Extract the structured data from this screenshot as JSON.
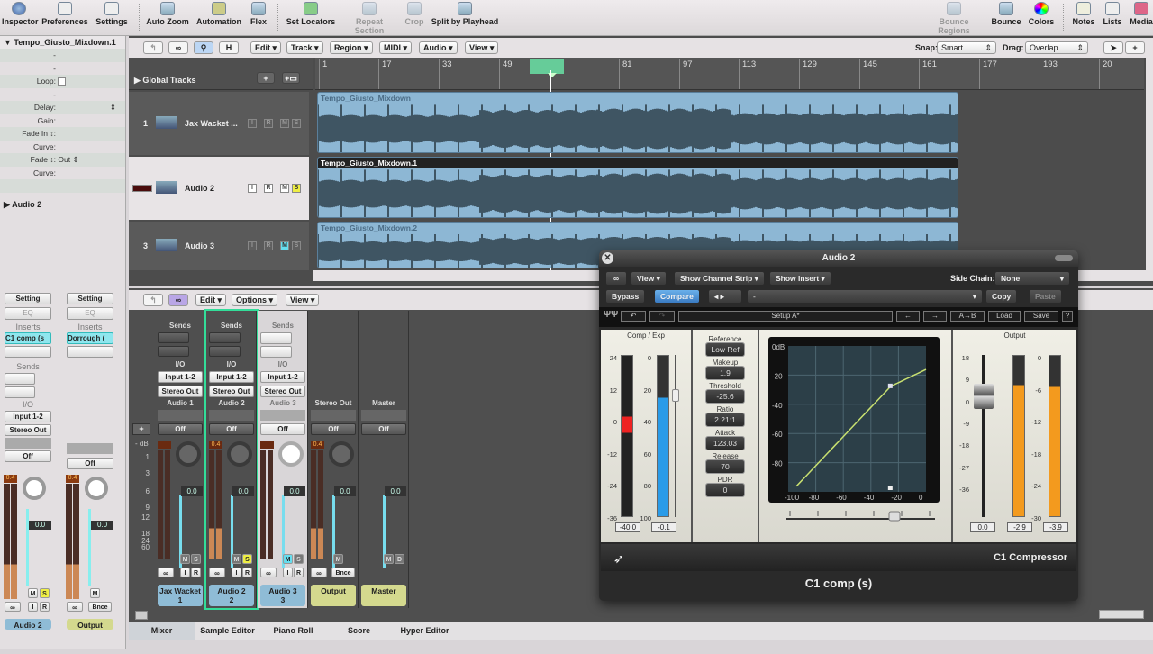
{
  "toolbar": {
    "items": [
      {
        "label": "Inspector",
        "icon": "info-icon"
      },
      {
        "label": "Preferences",
        "icon": "preferences-icon"
      },
      {
        "label": "Settings",
        "icon": "settings-icon"
      },
      {
        "label": "Auto Zoom",
        "icon": "auto-zoom-icon"
      },
      {
        "label": "Automation",
        "icon": "automation-icon"
      },
      {
        "label": "Flex",
        "icon": "flex-icon"
      },
      {
        "label": "Set Locators",
        "icon": "set-locators-icon"
      },
      {
        "label": "Repeat Section",
        "icon": "repeat-section-icon"
      },
      {
        "label": "Crop",
        "icon": "crop-icon"
      },
      {
        "label": "Split by Playhead",
        "icon": "split-icon"
      },
      {
        "label": "Bounce Regions",
        "icon": "bounce-regions-icon"
      },
      {
        "label": "Bounce",
        "icon": "bounce-icon"
      },
      {
        "label": "Colors",
        "icon": "colors-icon"
      },
      {
        "label": "Notes",
        "icon": "notes-icon"
      },
      {
        "label": "Lists",
        "icon": "lists-icon"
      },
      {
        "label": "Media",
        "icon": "media-icon"
      }
    ]
  },
  "inspector": {
    "region_name": "Tempo_Giusto_Mixdown.1",
    "dash": "-",
    "loop_label": "Loop:",
    "delay_label": "Delay:",
    "gain_label": "Gain:",
    "fade_in_label": "Fade In ↕:",
    "curve_label": "Curve:",
    "fade_label": "Fade ↕:",
    "fade_value": "Out",
    "track_section": "Audio 2",
    "strips": [
      {
        "setting": "Setting",
        "eq": "EQ",
        "inserts_label": "Inserts",
        "insert": "C1 comp (s",
        "sends_label": "Sends",
        "io_label": "I/O",
        "input": "Input 1-2",
        "output": "Stereo Out",
        "automation": "Off",
        "peak": "0.4",
        "volume": "0.0",
        "m": "M",
        "s": "S",
        "i": "I",
        "r": "R",
        "name": "Audio 2",
        "color": "#8fbcd6"
      },
      {
        "setting": "Setting",
        "eq": "EQ",
        "inserts_label": "Inserts",
        "insert": "Dorrough (",
        "automation": "Off",
        "peak": "0.4",
        "volume": "0.0",
        "m": "M",
        "bnce": "Bnce",
        "name": "Output",
        "color": "#d4d98e"
      }
    ]
  },
  "arrange": {
    "buttons": {
      "edit": "Edit",
      "track": "Track",
      "region": "Region",
      "midi": "MIDI",
      "audio": "Audio",
      "view": "View",
      "h": "H"
    },
    "snap_label": "Snap:",
    "snap_value": "Smart",
    "drag_label": "Drag:",
    "drag_value": "Overlap",
    "global_tracks": "Global Tracks",
    "ruler": [
      "1",
      "17",
      "33",
      "49",
      "81",
      "97",
      "113",
      "129",
      "145",
      "161",
      "177",
      "193",
      "20"
    ],
    "tracks": [
      {
        "num": "1",
        "name": "Jax Wacket ...",
        "region": "Tempo_Giusto_Mixdown",
        "selected": false,
        "solo": false,
        "mute": false
      },
      {
        "num": "",
        "name": "Audio 2",
        "region": "Tempo_Giusto_Mixdown.1",
        "selected": true,
        "solo": true,
        "mute": false
      },
      {
        "num": "3",
        "name": "Audio 3",
        "region": "Tempo_Giusto_Mixdown.2",
        "selected": false,
        "solo": false,
        "mute": true
      }
    ],
    "isr": {
      "i": "I",
      "r": "R",
      "m": "M",
      "s": "S"
    }
  },
  "mixer": {
    "buttons": {
      "edit": "Edit",
      "options": "Options",
      "view": "View"
    },
    "db_label": "- dB",
    "scale": [
      "1",
      "3",
      "6",
      "9",
      "12",
      "18",
      "24",
      "60"
    ],
    "strips": [
      {
        "sends": "Sends",
        "io": "I/O",
        "input": "Input 1-2",
        "output": "Stereo Out",
        "title": "Audio 1",
        "auto": "Off",
        "peak": "",
        "vol": "0.0",
        "btns": [
          "M",
          "S"
        ],
        "name": "Jax Wacket",
        "num": "1",
        "color": "#8fbcd6"
      },
      {
        "sends": "Sends",
        "io": "I/O",
        "input": "Input 1-2",
        "output": "Stereo Out",
        "title": "Audio 2",
        "auto": "Off",
        "peak": "0.4",
        "vol": "0.0",
        "btns": [
          "M",
          "S"
        ],
        "name": "Audio 2",
        "num": "2",
        "color": "#8fbcd6",
        "solo": true,
        "selected": true
      },
      {
        "sends": "Sends",
        "io": "I/O",
        "input": "Input 1-2",
        "output": "Stereo Out",
        "title": "Audio 3",
        "auto": "Off",
        "peak": "",
        "vol": "0.0",
        "btns": [
          "M",
          "S"
        ],
        "name": "Audio 3",
        "num": "3",
        "color": "#8fbcd6",
        "mute": true,
        "light": true
      },
      {
        "title": "Stereo Out",
        "auto": "Off",
        "peak": "0.4",
        "vol": "0.0",
        "btns": [
          "M"
        ],
        "bnce": "Bnce",
        "name": "Output",
        "num": "",
        "color": "#d4d98e"
      },
      {
        "title": "Master",
        "auto": "Off",
        "peak": "",
        "vol": "0.0",
        "btns": [
          "M",
          "D"
        ],
        "name": "Master",
        "num": "",
        "color": "#d4d98e"
      }
    ],
    "tabs": [
      "Mixer",
      "Sample Editor",
      "Piano Roll",
      "Score",
      "Hyper Editor"
    ]
  },
  "plugin": {
    "title": "Audio 2",
    "view": "View",
    "show_channel_strip": "Show Channel Strip",
    "show_insert": "Show Insert",
    "side_chain_label": "Side Chain:",
    "side_chain_value": "None",
    "bypass": "Bypass",
    "compare": "Compare",
    "preset": "-",
    "copy": "Copy",
    "paste": "Paste",
    "setup": "Setup A*",
    "ab": "A→B",
    "load": "Load",
    "save": "Save",
    "help": "?",
    "comp_exp_label": "Comp / Exp",
    "left_scale": [
      "24",
      "12",
      "0",
      "-12",
      "-24",
      "-36"
    ],
    "gr_scale": [
      "0",
      "20",
      "40",
      "60",
      "80",
      "100"
    ],
    "comp_exp_value": "-40.0",
    "gr_value": "-0.1",
    "params": [
      {
        "label": "Reference",
        "value": "Low Ref"
      },
      {
        "label": "Makeup",
        "value": "1.9"
      },
      {
        "label": "Threshold",
        "value": "-25.6"
      },
      {
        "label": "Ratio",
        "value": "2.21:1"
      },
      {
        "label": "Attack",
        "value": "123.03"
      },
      {
        "label": "Release",
        "value": "70"
      },
      {
        "label": "PDR",
        "value": "0"
      }
    ],
    "graph_y": [
      "0dB",
      "-20",
      "-40",
      "-60",
      "-80"
    ],
    "graph_x": [
      "-100",
      "-80",
      "-60",
      "-40",
      "-20",
      "0"
    ],
    "output_label": "Output",
    "fader_scale": [
      "18",
      "9",
      "0",
      "-9",
      "-18",
      "-27",
      "-36"
    ],
    "meter_scale": [
      "0",
      "-6",
      "-12",
      "-18",
      "-24",
      "-30"
    ],
    "output_values": [
      "0.0",
      "-2.9",
      "-3.9"
    ],
    "output_meter_levels": [
      -5.5,
      -5.8
    ],
    "gr_meter_fraction": 0.74,
    "product": "C1 Compressor",
    "insert_name": "C1 comp (s)"
  }
}
